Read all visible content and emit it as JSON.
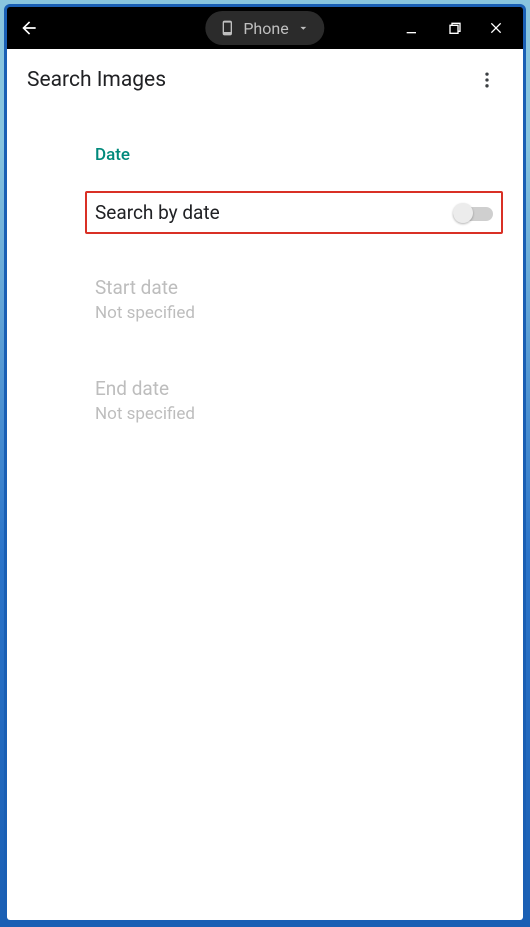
{
  "titlebar": {
    "device_label": "Phone"
  },
  "header": {
    "title": "Search Images"
  },
  "section": {
    "label": "Date",
    "toggle_label": "Search by date",
    "toggle_on": false,
    "start_date": {
      "label": "Start date",
      "value": "Not specified"
    },
    "end_date": {
      "label": "End date",
      "value": "Not specified"
    }
  },
  "colors": {
    "accent": "#00897b",
    "highlight_border": "#d93025"
  }
}
